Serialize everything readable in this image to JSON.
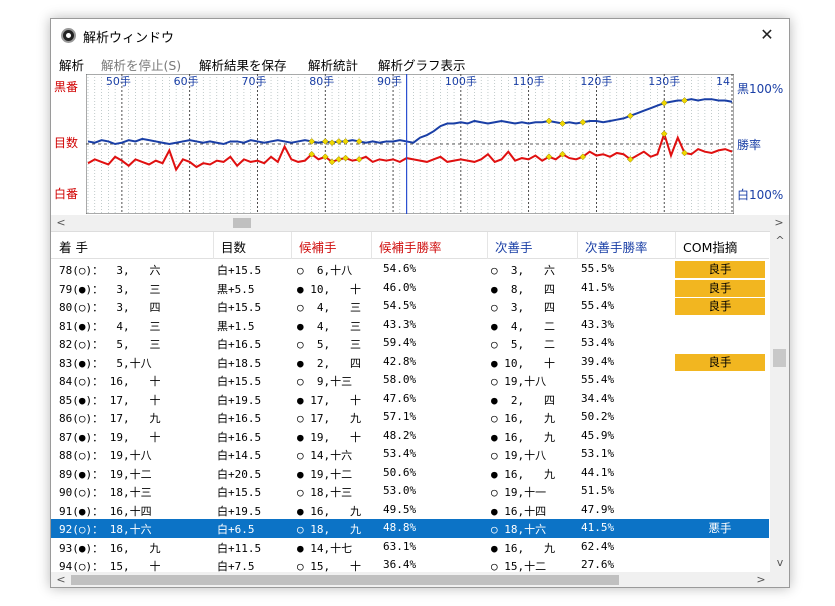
{
  "window": {
    "title": "解析ウィンドウ",
    "close": "✕"
  },
  "menu": [
    {
      "label": "解析",
      "disabled": false
    },
    {
      "label": "解析を停止(S)",
      "disabled": true
    },
    {
      "label": "解析結果を保存",
      "disabled": false
    },
    {
      "label": "解析統計",
      "disabled": false
    },
    {
      "label": "解析グラフ表示",
      "disabled": false
    }
  ],
  "graph": {
    "left_labels": {
      "top": "黒番",
      "mid": "目数",
      "bottom": "白番"
    },
    "right_labels": {
      "top": "黒100%",
      "mid": "勝率",
      "bottom": "白100%"
    },
    "move_ticks": [
      "50手",
      "60手",
      "70手",
      "80手",
      "90手",
      "100手",
      "110手",
      "120手",
      "130手",
      "14"
    ],
    "colors": {
      "winrate": "#1a3fa6",
      "score": "#e01010",
      "marker": "#f0d800",
      "cursor": "#2a4fd0",
      "left_label": "#d00000",
      "right_label": "#1a3fa6"
    }
  },
  "chart_data": {
    "type": "line",
    "x_start": 45,
    "x_end": 140,
    "cursor_move": 92,
    "series": [
      {
        "name": "勝率",
        "values": [
          52,
          51,
          53,
          52,
          50,
          51,
          53,
          52,
          54,
          53,
          52,
          51,
          50,
          51,
          52,
          53,
          52,
          51,
          52,
          51,
          50,
          52,
          52,
          51,
          53,
          52,
          51,
          52,
          53,
          52,
          51,
          52,
          53,
          52,
          51,
          52,
          51,
          52,
          52,
          53,
          52,
          51,
          52,
          51,
          52,
          52,
          53,
          52,
          51,
          55,
          57,
          60,
          64,
          66,
          66,
          67,
          66,
          68,
          67,
          66,
          67,
          68,
          67,
          66,
          67,
          66,
          67,
          67,
          68,
          67,
          66,
          67,
          66,
          67,
          68,
          68,
          67,
          68,
          69,
          70,
          72,
          74,
          76,
          78,
          80,
          82,
          83,
          84,
          84,
          85,
          84,
          85,
          85,
          84,
          84,
          83
        ]
      },
      {
        "name": "目数",
        "values": [
          35,
          38,
          36,
          34,
          40,
          37,
          33,
          38,
          36,
          34,
          37,
          35,
          45,
          30,
          38,
          36,
          32,
          35,
          34,
          37,
          36,
          40,
          33,
          38,
          36,
          37,
          35,
          40,
          36,
          48,
          38,
          36,
          37,
          42,
          38,
          40,
          36,
          38,
          39,
          37,
          38,
          40,
          36,
          38,
          37,
          38,
          36,
          39,
          38,
          37,
          36,
          38,
          40,
          36,
          37,
          38,
          37,
          36,
          38,
          42,
          36,
          38,
          44,
          37,
          39,
          38,
          41,
          37,
          40,
          38,
          42,
          39,
          38,
          40,
          44,
          41,
          42,
          40,
          43,
          42,
          38,
          41,
          44,
          40,
          42,
          58,
          41,
          55,
          43,
          42,
          46,
          44,
          43,
          45,
          46,
          44
        ]
      }
    ]
  },
  "table": {
    "headers": [
      "着 手",
      "目数",
      "候補手",
      "候補手勝率",
      "次善手",
      "次善手勝率",
      "COM指摘"
    ],
    "header_colors": [
      "#000000",
      "#000000",
      "#d01010",
      "#d01010",
      "#1a3fa6",
      "#1a3fa6",
      "#000000"
    ],
    "rows": [
      {
        "move": "78(○)：  3,   六",
        "score": "白+15.5",
        "cand": "○  6,十八",
        "cand_wr": "54.6%",
        "next": "○  3,   六",
        "next_wr": "55.5%",
        "com": "良手",
        "selected": false
      },
      {
        "move": "79(●)：  3,   三",
        "score": "黒+5.5",
        "cand": "● 10,   十",
        "cand_wr": "46.0%",
        "next": "●  8,   四",
        "next_wr": "41.5%",
        "com": "良手",
        "selected": false
      },
      {
        "move": "80(○)：  3,   四",
        "score": "白+15.5",
        "cand": "○  4,   三",
        "cand_wr": "54.5%",
        "next": "○  3,   四",
        "next_wr": "55.4%",
        "com": "良手",
        "selected": false
      },
      {
        "move": "81(●)：  4,   三",
        "score": "黒+1.5",
        "cand": "●  4,   三",
        "cand_wr": "43.3%",
        "next": "●  4,   二",
        "next_wr": "43.3%",
        "com": "",
        "selected": false
      },
      {
        "move": "82(○)：  5,   三",
        "score": "白+16.5",
        "cand": "○  5,   三",
        "cand_wr": "59.4%",
        "next": "○  5,   二",
        "next_wr": "53.4%",
        "com": "",
        "selected": false
      },
      {
        "move": "83(●)：  5,十八",
        "score": "白+18.5",
        "cand": "●  2,   四",
        "cand_wr": "42.8%",
        "next": "● 10,   十",
        "next_wr": "39.4%",
        "com": "良手",
        "selected": false
      },
      {
        "move": "84(○)： 16,   十",
        "score": "白+15.5",
        "cand": "○  9,十三",
        "cand_wr": "58.0%",
        "next": "○ 19,十八",
        "next_wr": "55.4%",
        "com": "",
        "selected": false
      },
      {
        "move": "85(●)： 17,   十",
        "score": "白+19.5",
        "cand": "● 17,   十",
        "cand_wr": "47.6%",
        "next": "●  2,   四",
        "next_wr": "34.4%",
        "com": "",
        "selected": false
      },
      {
        "move": "86(○)： 17,   九",
        "score": "白+16.5",
        "cand": "○ 17,   九",
        "cand_wr": "57.1%",
        "next": "○ 16,   九",
        "next_wr": "50.2%",
        "com": "",
        "selected": false
      },
      {
        "move": "87(●)： 19,   十",
        "score": "白+16.5",
        "cand": "● 19,   十",
        "cand_wr": "48.2%",
        "next": "● 16,   九",
        "next_wr": "45.9%",
        "com": "",
        "selected": false
      },
      {
        "move": "88(○)： 19,十八",
        "score": "白+14.5",
        "cand": "○ 14,十六",
        "cand_wr": "53.4%",
        "next": "○ 19,十八",
        "next_wr": "53.1%",
        "com": "",
        "selected": false
      },
      {
        "move": "89(●)： 19,十二",
        "score": "白+20.5",
        "cand": "● 19,十二",
        "cand_wr": "50.6%",
        "next": "● 16,   九",
        "next_wr": "44.1%",
        "com": "",
        "selected": false
      },
      {
        "move": "90(○)： 18,十三",
        "score": "白+15.5",
        "cand": "○ 18,十三",
        "cand_wr": "53.0%",
        "next": "○ 19,十一",
        "next_wr": "51.5%",
        "com": "",
        "selected": false
      },
      {
        "move": "91(●)： 16,十四",
        "score": "白+19.5",
        "cand": "● 16,   九",
        "cand_wr": "49.5%",
        "next": "● 16,十四",
        "next_wr": "47.9%",
        "com": "",
        "selected": false
      },
      {
        "move": "92(○)： 18,十六",
        "score": "白+6.5",
        "cand": "○ 18,   九",
        "cand_wr": "48.8%",
        "next": "○ 18,十六",
        "next_wr": "41.5%",
        "com": "悪手",
        "selected": true
      },
      {
        "move": "93(●)： 16,   九",
        "score": "白+11.5",
        "cand": "● 14,十七",
        "cand_wr": "63.1%",
        "next": "● 16,   九",
        "next_wr": "62.4%",
        "com": "",
        "selected": false
      },
      {
        "move": "94(○)： 15,   十",
        "score": "白+7.5",
        "cand": "○ 15,   十",
        "cand_wr": "36.4%",
        "next": "○ 15,十二",
        "next_wr": "27.6%",
        "com": "",
        "selected": false
      }
    ]
  },
  "scroll_arrows": {
    "left": "<",
    "right": ">",
    "up": "^",
    "down": "v"
  }
}
